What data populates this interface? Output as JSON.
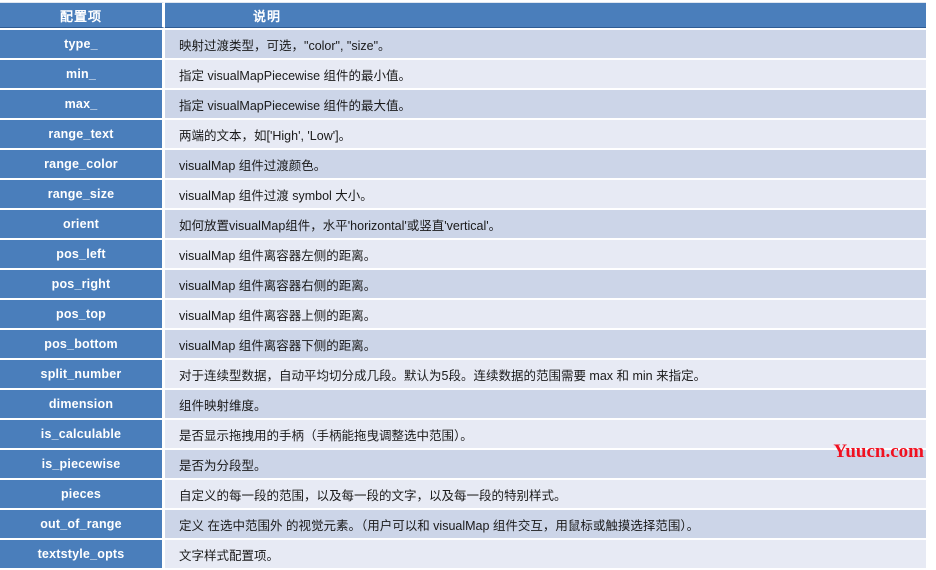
{
  "table": {
    "headers": {
      "key": "配置项",
      "description": "说明"
    },
    "rows": [
      {
        "key": "type_",
        "description": "映射过渡类型，可选，\"color\", \"size\"。"
      },
      {
        "key": "min_",
        "description": "指定 visualMapPiecewise 组件的最小值。"
      },
      {
        "key": "max_",
        "description": "指定 visualMapPiecewise 组件的最大值。"
      },
      {
        "key": "range_text",
        "description": "两端的文本，如['High', 'Low']。"
      },
      {
        "key": "range_color",
        "description": "visualMap 组件过渡颜色。"
      },
      {
        "key": "range_size",
        "description": "visualMap 组件过渡 symbol 大小。"
      },
      {
        "key": "orient",
        "description": "如何放置visualMap组件，水平'horizontal'或竖直'vertical'。"
      },
      {
        "key": "pos_left",
        "description": "visualMap 组件离容器左侧的距离。"
      },
      {
        "key": "pos_right",
        "description": "visualMap 组件离容器右侧的距离。"
      },
      {
        "key": "pos_top",
        "description": "visualMap 组件离容器上侧的距离。"
      },
      {
        "key": "pos_bottom",
        "description": "visualMap 组件离容器下侧的距离。"
      },
      {
        "key": "split_number",
        "description": "对于连续型数据，自动平均切分成几段。默认为5段。连续数据的范围需要 max 和 min 来指定。"
      },
      {
        "key": "dimension",
        "description": "组件映射维度。"
      },
      {
        "key": "is_calculable",
        "description": "是否显示拖拽用的手柄（手柄能拖曳调整选中范围）。"
      },
      {
        "key": "is_piecewise",
        "description": "是否为分段型。"
      },
      {
        "key": "pieces",
        "description": "自定义的每一段的范围，以及每一段的文字，以及每一段的特别样式。"
      },
      {
        "key": "out_of_range",
        "description": "定义 在选中范围外 的视觉元素。（用户可以和 visualMap 组件交互，用鼠标或触摸选择范围）。"
      },
      {
        "key": "textstyle_opts",
        "description": "文字样式配置项。"
      }
    ]
  },
  "watermark": {
    "text": "Yuucn.com"
  },
  "colors": {
    "header_bg": "#4a7ebb",
    "key_bg": "#4a7ebb",
    "row_dark": "#ccd5e8",
    "row_light": "#e7eaf4",
    "watermark": "#f01020"
  }
}
